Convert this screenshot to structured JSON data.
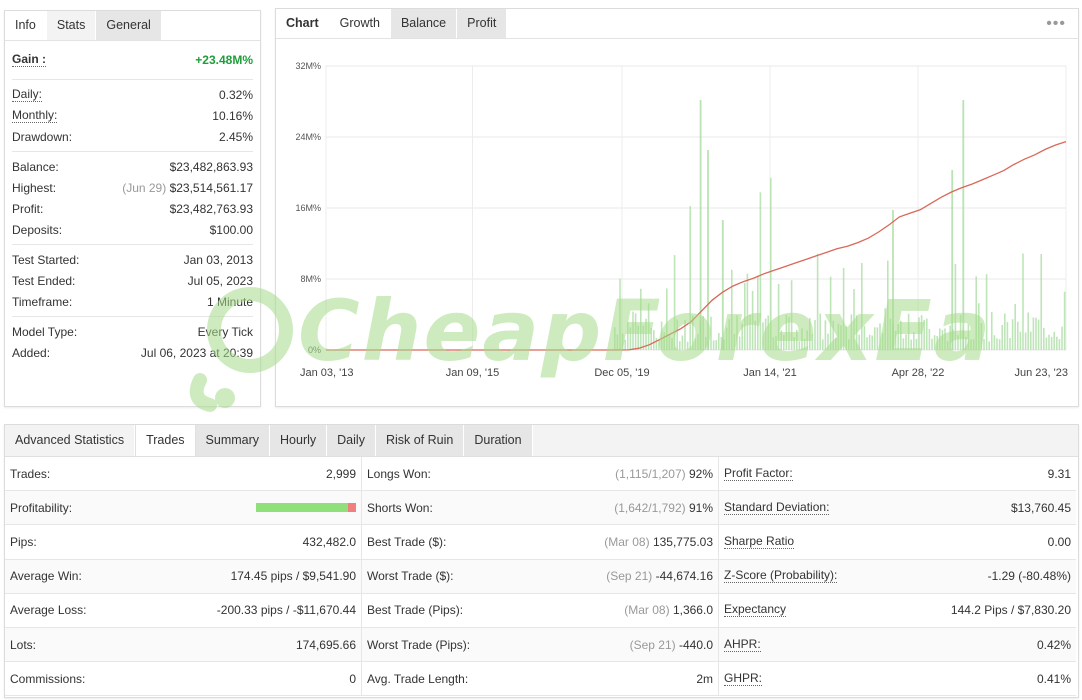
{
  "info_panel": {
    "tabs": [
      "Info",
      "Stats",
      "General"
    ],
    "gain": {
      "label": "Gain :",
      "value": "+23.48M%"
    },
    "group1": [
      {
        "label": "Daily:",
        "value": "0.32%",
        "underline": true
      },
      {
        "label": "Monthly:",
        "value": "10.16%",
        "underline": true
      },
      {
        "label": "Drawdown:",
        "value": "2.45%",
        "underline": false
      }
    ],
    "balance": {
      "label": "Balance:",
      "value": "$23,482,863.93"
    },
    "highest": {
      "label": "Highest:",
      "note": "(Jun 29)",
      "value": "$23,514,561.17"
    },
    "profit": {
      "label": "Profit:",
      "value": "$23,482,763.93"
    },
    "deposits": {
      "label": "Deposits:",
      "value": "$100.00"
    },
    "group3": [
      {
        "label": "Test Started:",
        "value": "Jan 03, 2013"
      },
      {
        "label": "Test Ended:",
        "value": "Jul 05, 2023"
      },
      {
        "label": "Timeframe:",
        "value": "1 Minute"
      }
    ],
    "group4": [
      {
        "label": "Model Type:",
        "value": "Every Tick"
      },
      {
        "label": "Added:",
        "value": "Jul 06, 2023 at 20:39"
      }
    ]
  },
  "chart_panel": {
    "tabs": [
      "Chart",
      "Growth",
      "Balance",
      "Profit"
    ],
    "menu": "•••"
  },
  "chart_data": {
    "type": "line",
    "y_ticks": [
      "0%",
      "8M%",
      "16M%",
      "24M%",
      "32M%"
    ],
    "x_ticks": [
      "Jan 03, '13",
      "Jan 09, '15",
      "Dec 05, '19",
      "Jan 14, '21",
      "Apr 28, '22",
      "Jun 23, '23"
    ],
    "ylim": [
      0,
      32000000
    ],
    "grid": true,
    "colors": {
      "growth_line": "#d9685a",
      "volume_bars": "#a8dca0"
    },
    "series": [
      {
        "values": [
          0,
          0,
          0,
          0,
          0,
          10000,
          200000,
          600000,
          1200000,
          1800000,
          2400000,
          3200000,
          4400000,
          5600000,
          6500000,
          7200000,
          7700000,
          8100000,
          8600000,
          9000000,
          9400000,
          9800000,
          10200000,
          10600000,
          11000000,
          11400000,
          11700000,
          12100000,
          12600000,
          13300000,
          14100000,
          15000000,
          15400000,
          15800000,
          16500000,
          17200000,
          17800000,
          18300000,
          18700000,
          19200000,
          19700000,
          20200000,
          20900000,
          21500000,
          22000000,
          22600000,
          23100000,
          23480000
        ]
      }
    ]
  },
  "watermark": {
    "text": "CheapForexEa"
  },
  "stats_panel": {
    "tabs": [
      "Advanced Statistics",
      "Trades",
      "Summary",
      "Hourly",
      "Daily",
      "Risk of Ruin",
      "Duration"
    ],
    "profitability": {
      "label": "Profitability:",
      "win_fraction": 0.92
    },
    "rows": [
      [
        {
          "label": "Trades:",
          "value": "2,999"
        },
        {
          "label": "Longs Won:",
          "note": "(1,115/1,207)",
          "value": "92%"
        },
        {
          "label": "Profit Factor:",
          "value": "9.31",
          "underline": true
        }
      ],
      [
        {
          "label": "Profitability:",
          "bar": true
        },
        {
          "label": "Shorts Won:",
          "note": "(1,642/1,792)",
          "value": "91%"
        },
        {
          "label": "Standard Deviation:",
          "value": "$13,760.45",
          "underline": true
        }
      ],
      [
        {
          "label": "Pips:",
          "value": "432,482.0"
        },
        {
          "label": "Best Trade ($):",
          "note": "(Mar 08)",
          "value": "135,775.03"
        },
        {
          "label": "Sharpe Ratio",
          "value": "0.00",
          "underline": true
        }
      ],
      [
        {
          "label": "Average Win:",
          "value": "174.45 pips / $9,541.90"
        },
        {
          "label": "Worst Trade ($):",
          "note": "(Sep 21)",
          "value": "-44,674.16"
        },
        {
          "label": "Z-Score (Probability):",
          "value": "-1.29 (-80.48%)",
          "underline": true
        }
      ],
      [
        {
          "label": "Average Loss:",
          "value": "-200.33 pips / -$11,670.44"
        },
        {
          "label": "Best Trade (Pips):",
          "note": "(Mar 08)",
          "value": "1,366.0"
        },
        {
          "label": "Expectancy",
          "value": "144.2 Pips / $7,830.20",
          "underline": true
        }
      ],
      [
        {
          "label": "Lots:",
          "value": "174,695.66"
        },
        {
          "label": "Worst Trade (Pips):",
          "note": "(Sep 21)",
          "value": "-440.0"
        },
        {
          "label": "AHPR:",
          "value": "0.42%",
          "underline": true
        }
      ],
      [
        {
          "label": "Commissions:",
          "value": "0"
        },
        {
          "label": "Avg. Trade Length:",
          "value": "2m"
        },
        {
          "label": "GHPR:",
          "value": "0.41%",
          "underline": true
        }
      ]
    ]
  }
}
